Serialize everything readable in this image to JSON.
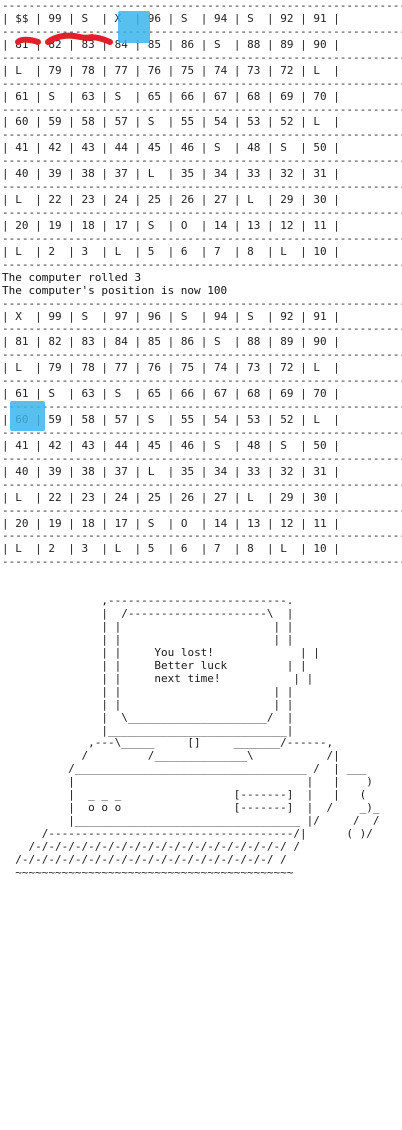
{
  "board_before": {
    "rows": [
      [
        "$$",
        "99",
        "S",
        "X",
        "96",
        "S",
        "94",
        "S",
        "92",
        "91"
      ],
      [
        "81",
        "82",
        "83",
        "84",
        "85",
        "86",
        "S",
        "88",
        "89",
        "90"
      ],
      [
        "L",
        "79",
        "78",
        "77",
        "76",
        "75",
        "74",
        "73",
        "72",
        "L"
      ],
      [
        "61",
        "S",
        "63",
        "S",
        "65",
        "66",
        "67",
        "68",
        "69",
        "70"
      ],
      [
        "60",
        "59",
        "58",
        "57",
        "S",
        "55",
        "54",
        "53",
        "52",
        "L"
      ],
      [
        "41",
        "42",
        "43",
        "44",
        "45",
        "46",
        "S",
        "48",
        "S",
        "50"
      ],
      [
        "40",
        "39",
        "38",
        "37",
        "L",
        "35",
        "34",
        "33",
        "32",
        "31"
      ],
      [
        "L",
        "22",
        "23",
        "24",
        "25",
        "26",
        "27",
        "L",
        "29",
        "30"
      ],
      [
        "20",
        "19",
        "18",
        "17",
        "S",
        "O",
        "14",
        "13",
        "12",
        "11"
      ],
      [
        "L",
        "2",
        "3",
        "L",
        "5",
        "6",
        "7",
        "8",
        "L",
        "10"
      ]
    ],
    "highlighted_cell": "X"
  },
  "messages": [
    "The computer rolled 3",
    "The computer's position is now 100"
  ],
  "board_after": {
    "rows": [
      [
        "X",
        "99",
        "S",
        "97",
        "96",
        "S",
        "94",
        "S",
        "92",
        "91"
      ],
      [
        "81",
        "82",
        "83",
        "84",
        "85",
        "86",
        "S",
        "88",
        "89",
        "90"
      ],
      [
        "L",
        "79",
        "78",
        "77",
        "76",
        "75",
        "74",
        "73",
        "72",
        "L"
      ],
      [
        "61",
        "S",
        "63",
        "S",
        "65",
        "66",
        "67",
        "68",
        "69",
        "70"
      ],
      [
        "60",
        "59",
        "58",
        "57",
        "S",
        "55",
        "54",
        "53",
        "52",
        "L"
      ],
      [
        "41",
        "42",
        "43",
        "44",
        "45",
        "46",
        "S",
        "48",
        "S",
        "50"
      ],
      [
        "40",
        "39",
        "38",
        "37",
        "L",
        "35",
        "34",
        "33",
        "32",
        "31"
      ],
      [
        "L",
        "22",
        "23",
        "24",
        "25",
        "26",
        "27",
        "L",
        "29",
        "30"
      ],
      [
        "20",
        "19",
        "18",
        "17",
        "S",
        "O",
        "14",
        "13",
        "12",
        "11"
      ],
      [
        "L",
        "2",
        "3",
        "L",
        "5",
        "6",
        "7",
        "8",
        "L",
        "10"
      ]
    ],
    "highlighted_cell": "X"
  },
  "result_screen": {
    "line1": "You lost!",
    "line2": "Better luck",
    "line3": "next time!"
  },
  "colors": {
    "highlight": "#3bb5ec",
    "scribble": "#e0202a"
  }
}
